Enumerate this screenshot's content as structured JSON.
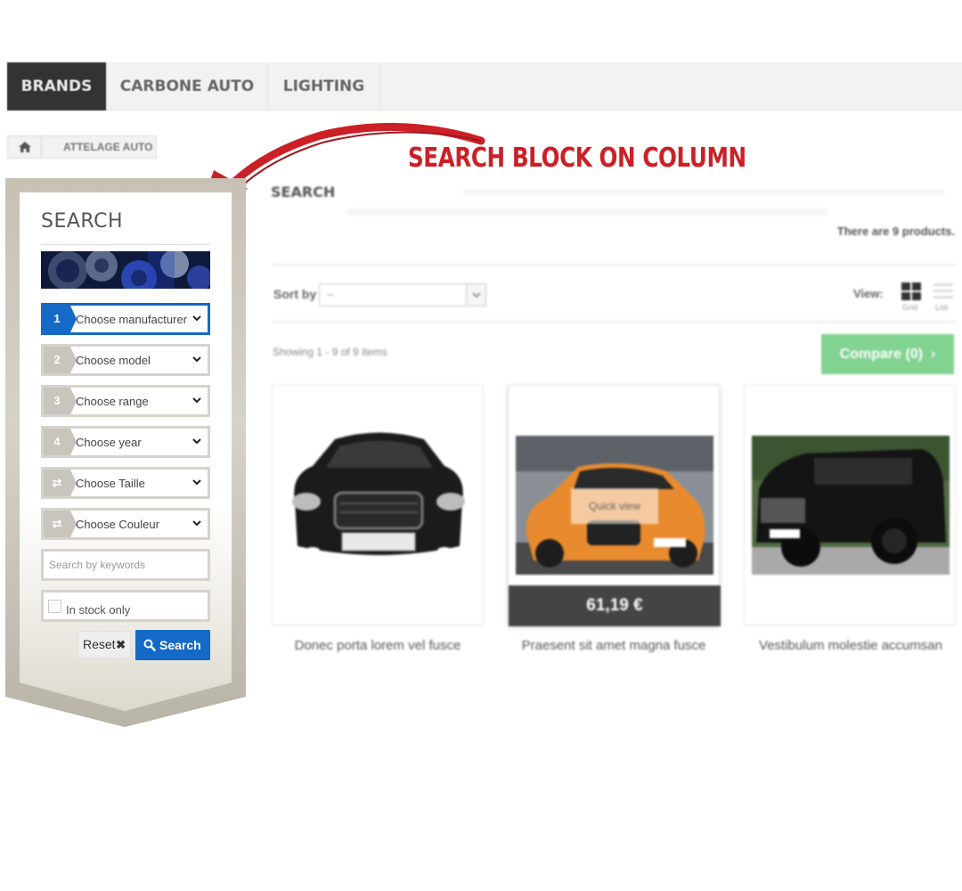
{
  "nav": {
    "items": [
      {
        "label": "BRANDS",
        "active": true
      },
      {
        "label": "CARBONE AUTO",
        "active": false
      },
      {
        "label": "LIGHTING",
        "active": false
      }
    ]
  },
  "breadcrumb": {
    "home_icon": "home-icon",
    "label": "ATTELAGE AUTO"
  },
  "annotation": {
    "text": "SEARCH BLOCK ON COLUMN",
    "color": "#cc2027"
  },
  "search_block": {
    "title": "SEARCH",
    "selects": [
      {
        "step": "1",
        "label": "Choose manufacturer",
        "active": true
      },
      {
        "step": "2",
        "label": "Choose model",
        "active": false
      },
      {
        "step": "3",
        "label": "Choose range",
        "active": false
      },
      {
        "step": "4",
        "label": "Choose year",
        "active": false
      },
      {
        "step": "⇄",
        "label": "Choose Taille",
        "active": false
      },
      {
        "step": "⇄",
        "label": "Choose Couleur",
        "active": false
      }
    ],
    "keywords_placeholder": "Search by keywords",
    "in_stock_label": "In stock only",
    "reset_label": "Reset",
    "search_label": "Search",
    "accent_color": "#1569c7"
  },
  "main": {
    "title": "SEARCH",
    "count_text": "There are 9 products.",
    "sort_label": "Sort by",
    "sort_value": "--",
    "view_label": "View:",
    "grid_label": "Grid",
    "list_label": "List",
    "showing_text": "Showing 1 - 9 of 9 items",
    "compare_label": "Compare (0)",
    "products": [
      {
        "name": "Donec porta lorem vel fusce",
        "price": "",
        "quick_view": ""
      },
      {
        "name": "Praesent sit amet magna fusce",
        "price": "61,19 €",
        "quick_view": "Quick view"
      },
      {
        "name": "Vestibulum molestie accumsan",
        "price": "",
        "quick_view": ""
      }
    ]
  }
}
